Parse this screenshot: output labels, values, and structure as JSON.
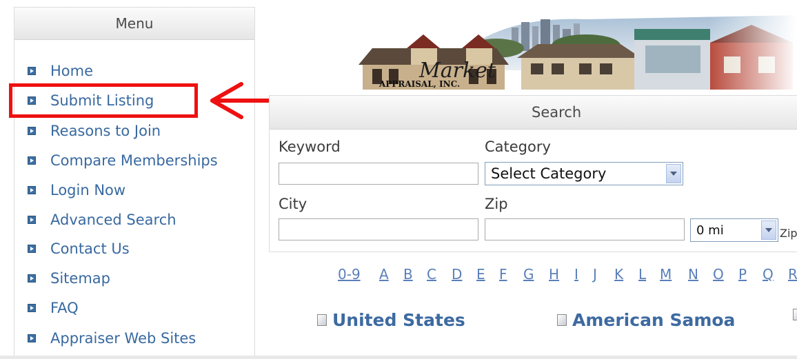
{
  "sidebar": {
    "title": "Menu",
    "items": [
      {
        "label": "Home"
      },
      {
        "label": "Submit Listing"
      },
      {
        "label": "Reasons to Join"
      },
      {
        "label": "Compare Memberships"
      },
      {
        "label": "Login Now"
      },
      {
        "label": "Advanced Search"
      },
      {
        "label": "Contact Us"
      },
      {
        "label": "Sitemap"
      },
      {
        "label": "FAQ"
      },
      {
        "label": "Appraiser Web Sites"
      }
    ]
  },
  "banner": {
    "logo_script": "Market",
    "logo_sub": "APPRAISAL, INC."
  },
  "search": {
    "title": "Search",
    "keyword_label": "Keyword",
    "keyword_value": "",
    "category_label": "Category",
    "category_selected": "Select Category",
    "city_label": "City",
    "city_value": "",
    "zip_label": "Zip",
    "zip_value": "",
    "radius_selected": "0 mi",
    "radius_trailing_label": "Zip"
  },
  "alphabet": [
    "0-9",
    "A",
    "B",
    "C",
    "D",
    "E",
    "F",
    "G",
    "H",
    "I",
    "J",
    "K",
    "L",
    "M",
    "N",
    "O",
    "P",
    "Q",
    "R"
  ],
  "countries": [
    {
      "label": "United States"
    },
    {
      "label": "American Samoa"
    }
  ],
  "colors": {
    "link": "#3869a0",
    "highlight": "#ee1111",
    "header_bg": "#e6e6e6"
  }
}
